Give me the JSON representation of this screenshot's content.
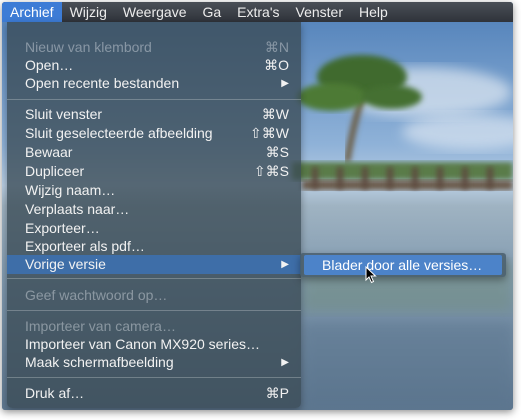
{
  "menubar": {
    "items": [
      "Archief",
      "Wijzig",
      "Weergave",
      "Ga",
      "Extra's",
      "Venster",
      "Help"
    ]
  },
  "menu": {
    "items": [
      {
        "label": "Nieuw van klembord",
        "shortcut": "⌘N"
      },
      {
        "label": "Open…",
        "shortcut": "⌘O"
      },
      {
        "label": "Open recente bestanden"
      },
      {
        "label": "Sluit venster",
        "shortcut": "⌘W"
      },
      {
        "label": "Sluit geselecteerde afbeelding",
        "shortcut": "⇧⌘W"
      },
      {
        "label": "Bewaar",
        "shortcut": "⌘S"
      },
      {
        "label": "Dupliceer",
        "shortcut": "⇧⌘S"
      },
      {
        "label": "Wijzig naam…"
      },
      {
        "label": "Verplaats naar…"
      },
      {
        "label": "Exporteer…"
      },
      {
        "label": "Exporteer als pdf…"
      },
      {
        "label": "Vorige versie"
      },
      {
        "label": "Geef wachtwoord op…"
      },
      {
        "label": "Importeer van camera…"
      },
      {
        "label": "Importeer van Canon MX920 series…"
      },
      {
        "label": "Maak schermafbeelding"
      },
      {
        "label": "Druk af…",
        "shortcut": "⌘P"
      }
    ],
    "submenu_arrow": "▶"
  },
  "submenu": {
    "items": [
      {
        "label": "Blader door alle versies…"
      }
    ]
  },
  "colors": {
    "menubar": "#2f333a",
    "selection": "#3e6ea8",
    "submenu_highlight": "#4c83c9"
  }
}
